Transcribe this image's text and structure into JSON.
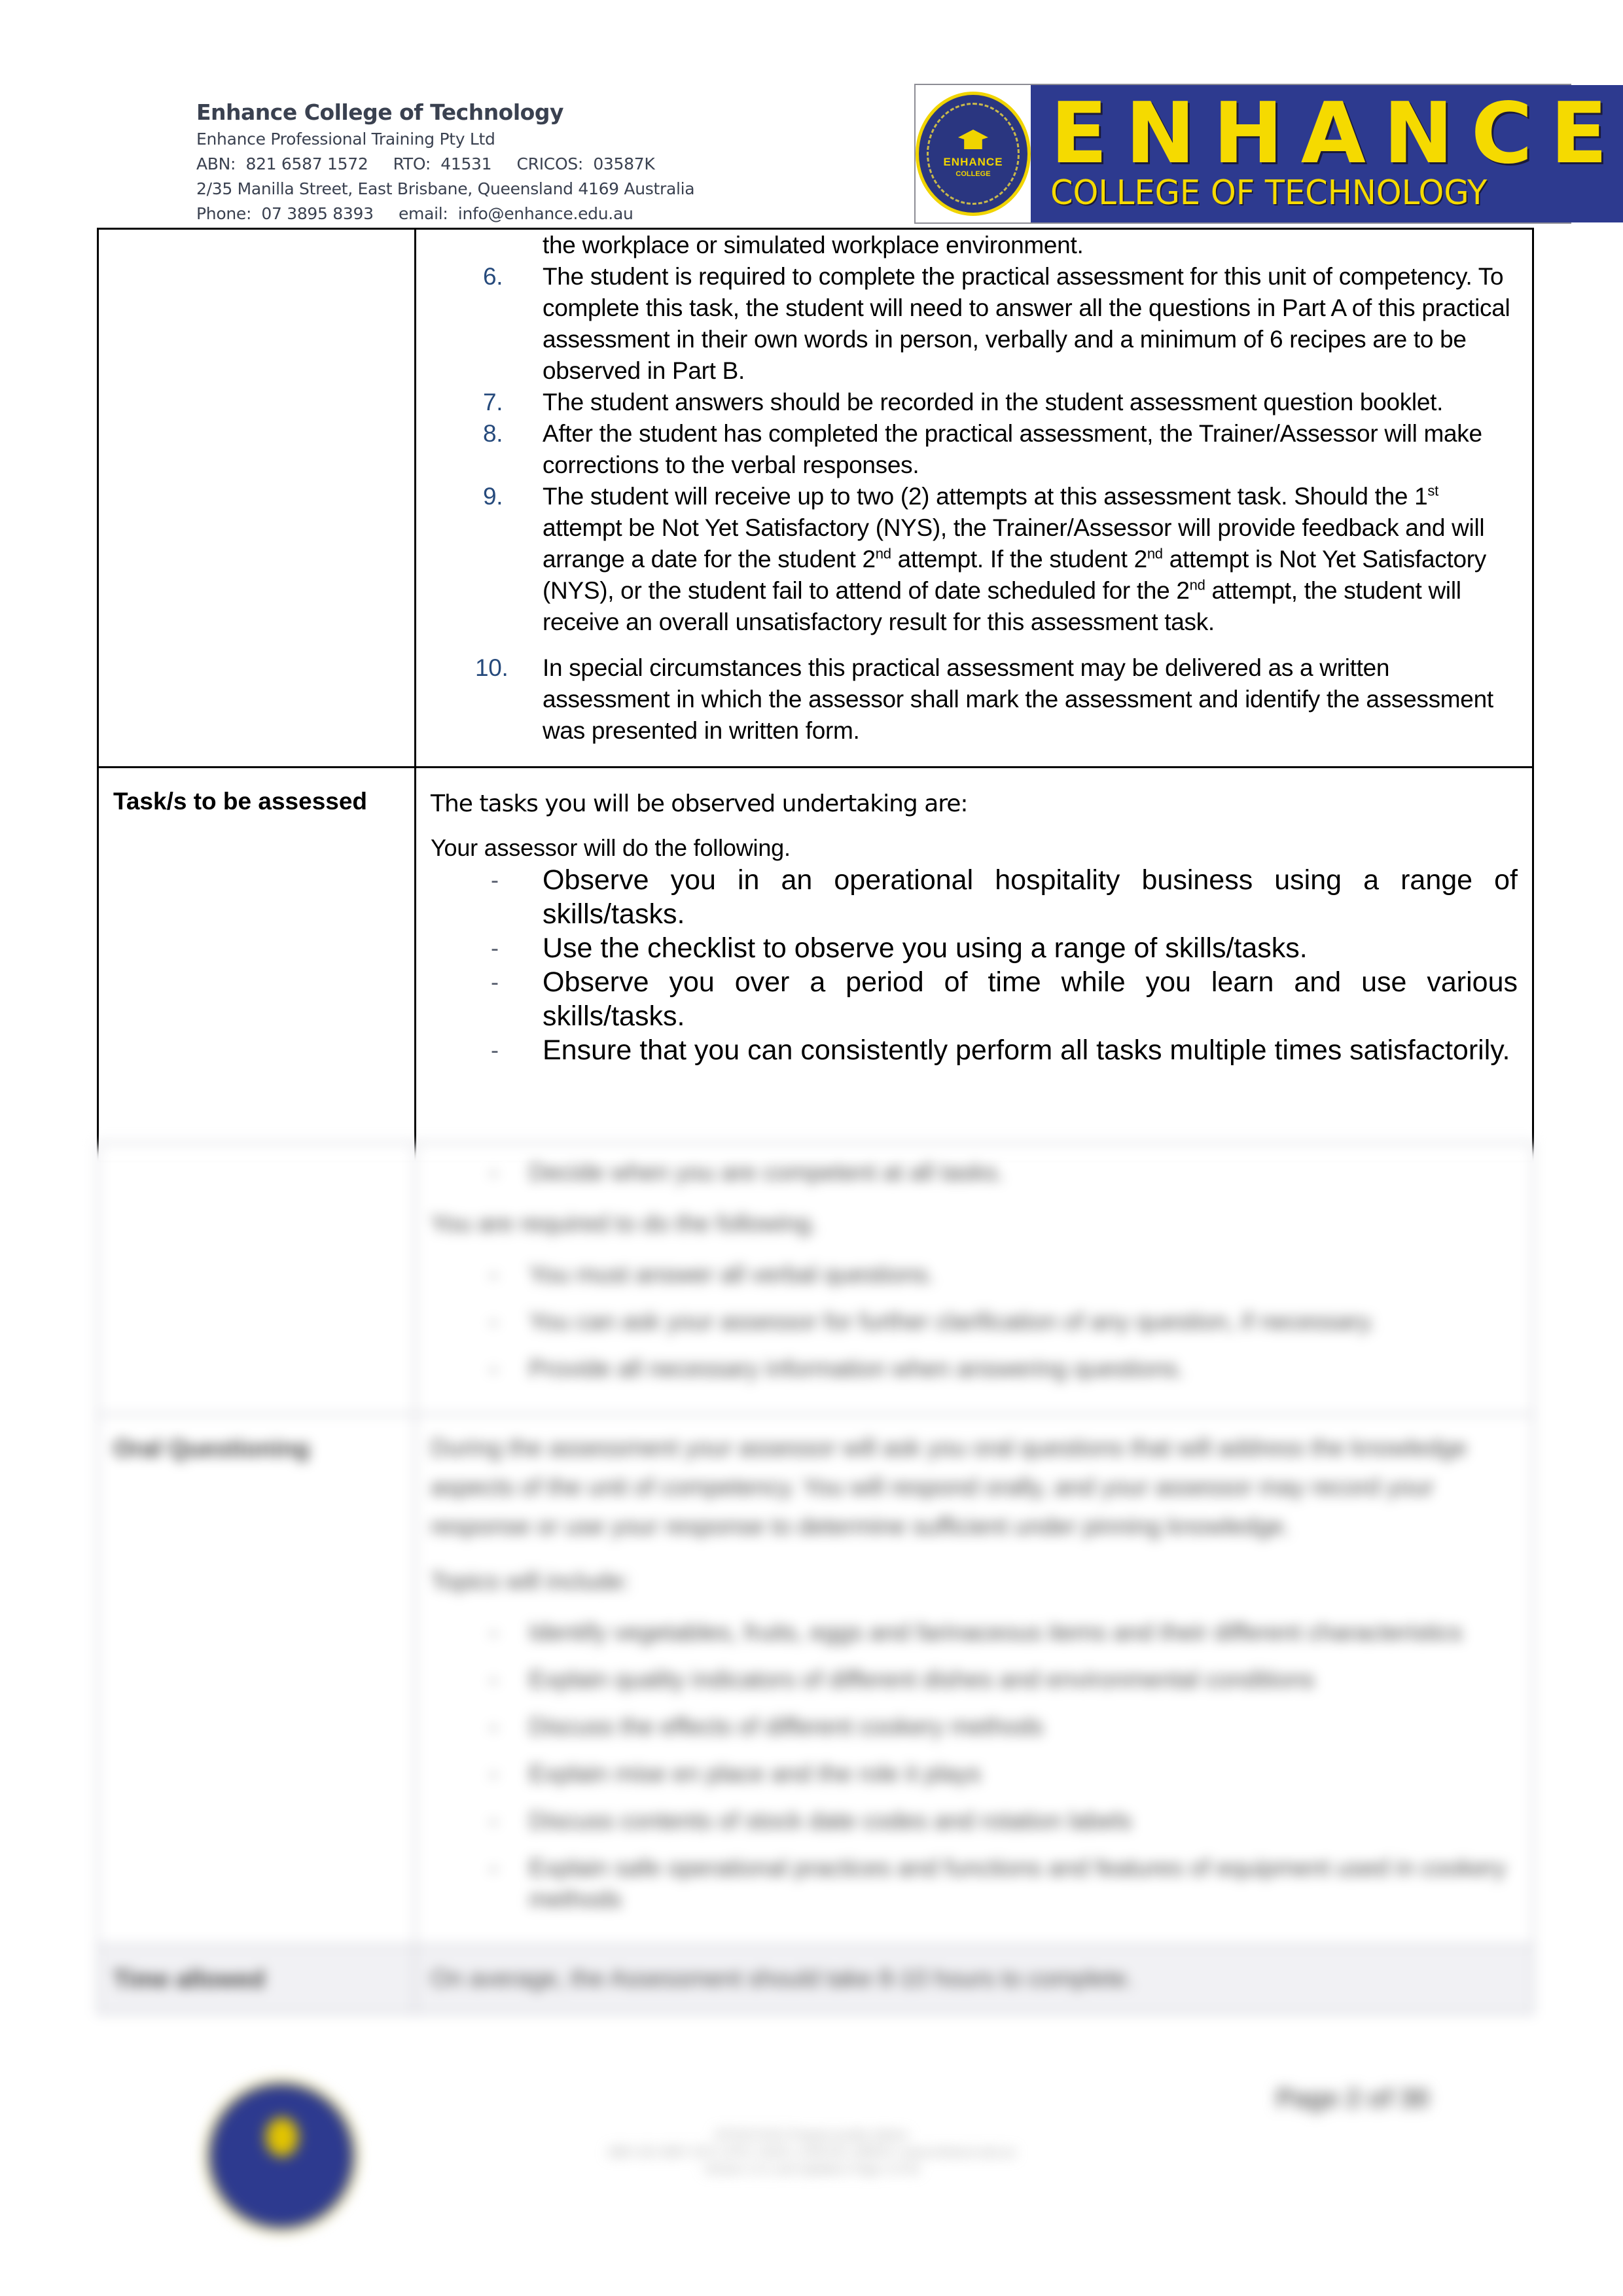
{
  "header": {
    "college_name": "Enhance College of Technology",
    "company": "Enhance Professional Training Pty Ltd",
    "registration_line": "ABN:  821 6587 1572     RTO:  41531     CRICOS:  03587K",
    "address": "2/35 Manilla Street, East Brisbane, Queensland 4169 Australia",
    "contact_line": "Phone:  07 3895 8393     email:  info@enhance.edu.au",
    "logo": {
      "big_text": "ENHANCE",
      "small_text": "COLLEGE OF TECHNOLOGY",
      "seal_text": "ENHANCE",
      "seal_sub": "COLLEGE",
      "brand_blue": "#2d3a8f",
      "brand_yellow": "#f5da00"
    }
  },
  "instructions": {
    "continued_text": "the workplace or simulated workplace environment.",
    "items": [
      {
        "num": "6.",
        "text": "The student is required to complete the practical assessment for this unit of competency. To complete this task, the student will need to answer all the questions in Part A of this practical assessment in their own words in person, verbally and a minimum of 6 recipes are to be observed in Part B."
      },
      {
        "num": "7.",
        "text": "The student answers should be recorded in the student assessment question booklet."
      },
      {
        "num": "8.",
        "text": "After the student has completed the practical assessment, the Trainer/Assessor will make corrections to the verbal responses."
      },
      {
        "num": "9.",
        "parts": [
          "The student will receive up to two (2) attempts at this assessment task. Should the 1",
          "st",
          " attempt be Not Yet Satisfactory (NYS), the Trainer/Assessor will provide feedback and will arrange a date for the student 2",
          "nd",
          " attempt. If the student 2",
          "nd",
          " attempt is Not Yet Satisfactory (NYS), or the student fail to attend of date scheduled for the 2",
          "nd",
          " attempt, the student will receive an overall unsatisfactory result for this assessment task."
        ]
      },
      {
        "num": "10.",
        "text": "In special circumstances this practical assessment may be delivered as a written assessment in which the assessor shall mark the assessment and identify the assessment was presented in written form."
      }
    ],
    "number_color": "#264a7c"
  },
  "tasks": {
    "label": "Task/s to be assessed",
    "intro": "The tasks you will be observed undertaking are:",
    "assessor_heading": "Your assessor will do the following.",
    "assessor_items": [
      "Observe you in an operational hospitality business using a range of skills/tasks.",
      "Use the checklist to observe you using a range of skills/tasks.",
      "Observe you over a period of time while you learn and use various skills/tasks.",
      "Ensure that you can consistently perform all tasks multiple times satisfactorily.",
      "Decide when you are competent at all tasks."
    ],
    "student_heading": "You are required to do the following.",
    "student_items": [
      "You must answer all verbal questions.",
      "You can ask your assessor for further clarification of any question, if necessary.",
      "Provide all necessary information when answering questions."
    ]
  },
  "oral": {
    "label": "Oral Questioning",
    "paragraph": "During the assessment your assessor will ask you oral questions that will address the knowledge aspects of the unit of competency. You will respond orally, and your assessor may record your response or use your response to determine sufficient under pinning knowledge.",
    "topics_heading": "Topics will include:",
    "topics": [
      "Identify vegetables, fruits, eggs and farinaceous items and their different characteristics",
      "Explain quality indicators of different dishes and environmental conditions",
      "Discuss the effects of different cookery methods",
      "Explain mise en place and the role it plays",
      "Discuss contents of stock date codes and rotation labels",
      "Explain safe operational practices and functions and features of equipment used in cookery methods"
    ]
  },
  "time": {
    "label": "Time allowed",
    "value": "On average, the Assessment should take 8-10 hours to complete."
  },
  "footer": {
    "page_label": "Page 2 of 30",
    "center_lines": [
      "SITHCCC012 Prepare poultry dishes",
      "ABN: 821 6587 1572  |  RTO: 41531  |  CRICOS: 03587K  |  www.enhance.edu.au",
      "Version 1.0  |  Last Updated  |  Page 2 of 30"
    ]
  }
}
